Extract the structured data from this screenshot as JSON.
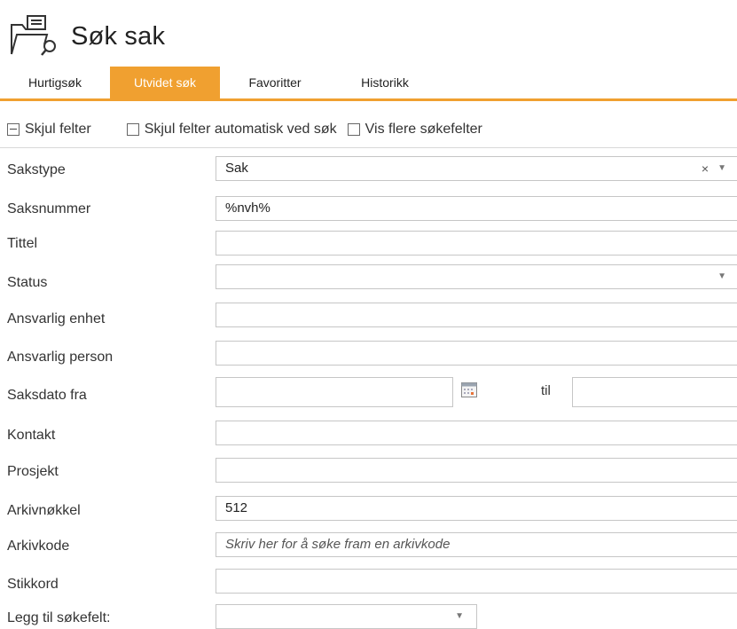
{
  "header": {
    "title": "Søk sak",
    "icon": "folder-search-icon"
  },
  "tabs": [
    {
      "label": "Hurtigsøk",
      "active": false
    },
    {
      "label": "Utvidet søk",
      "active": true
    },
    {
      "label": "Favoritter",
      "active": false
    },
    {
      "label": "Historikk",
      "active": false
    }
  ],
  "options": {
    "hide_fields": "Skjul felter",
    "auto_hide": "Skjul felter automatisk ved søk",
    "more_fields": "Vis flere søkefelter"
  },
  "fields": {
    "sakstype": {
      "label": "Sakstype",
      "value": "Sak",
      "clear": "×"
    },
    "saksnummer": {
      "label": "Saksnummer",
      "value": "%nvh%"
    },
    "tittel": {
      "label": "Tittel",
      "value": ""
    },
    "status": {
      "label": "Status",
      "value": ""
    },
    "ansvarlig_enhet": {
      "label": "Ansvarlig enhet",
      "value": ""
    },
    "ansvarlig_person": {
      "label": "Ansvarlig person",
      "value": ""
    },
    "saksdato": {
      "label": "Saksdato fra",
      "til": "til"
    },
    "kontakt": {
      "label": "Kontakt",
      "value": ""
    },
    "prosjekt": {
      "label": "Prosjekt",
      "value": ""
    },
    "arkivnokkel": {
      "label": "Arkivnøkkel",
      "value": "512"
    },
    "arkivkode": {
      "label": "Arkivkode",
      "placeholder": "Skriv her for å søke fram en arkivkode"
    },
    "stikkord": {
      "label": "Stikkord",
      "value": ""
    },
    "legg_til": {
      "label": "Legg til søkefelt:"
    }
  },
  "colors": {
    "accent": "#f0a030",
    "border": "#c6c6c6"
  }
}
